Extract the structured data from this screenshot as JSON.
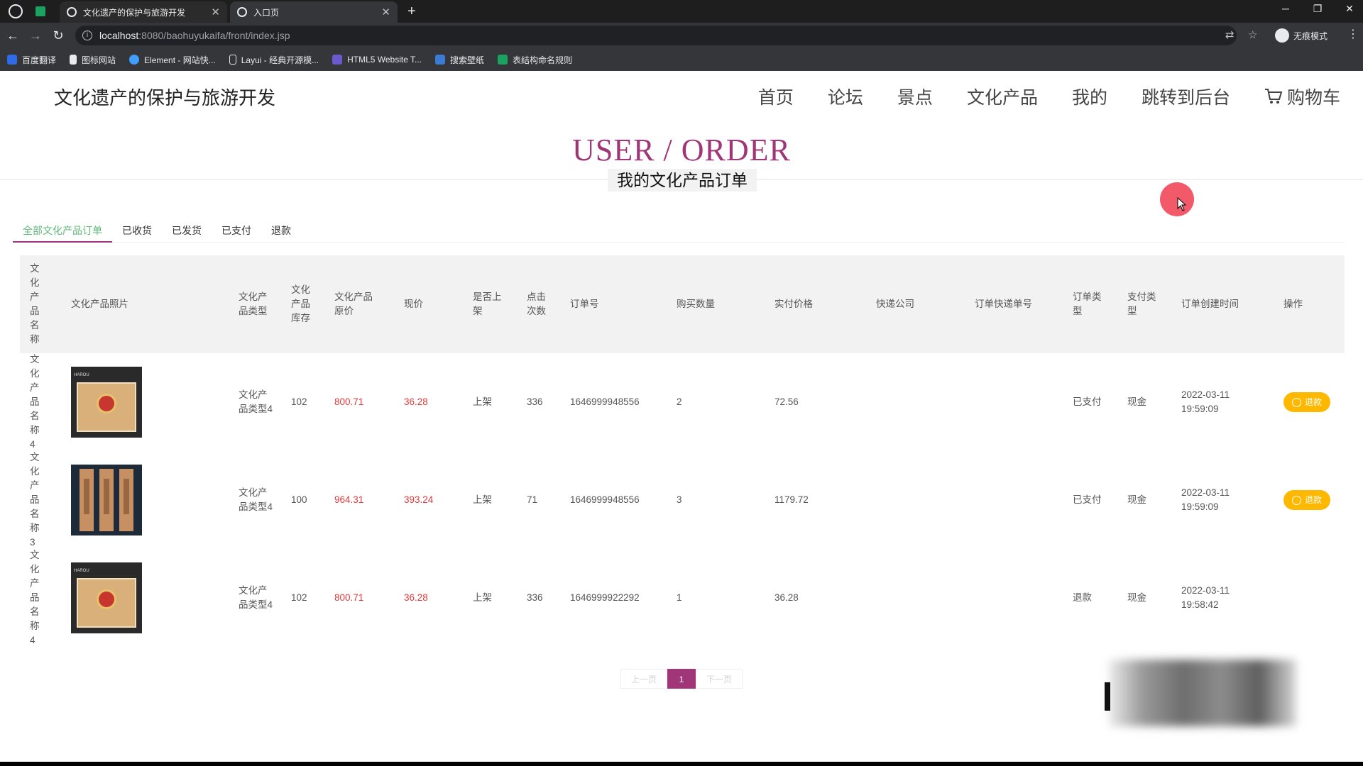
{
  "browser": {
    "tabs": [
      {
        "label": "文化遗产的保护与旅游开发"
      },
      {
        "label": "入口页"
      }
    ],
    "url_host": "localhost",
    "url_path": ":8080/baohuyukaifa/front/index.jsp",
    "incognito_label": "无痕模式",
    "bookmarks": [
      "百度翻译",
      "图标网站",
      "Element - 网站快...",
      "Layui - 经典开源模...",
      "HTML5 Website T...",
      "搜索壁纸",
      "表结构命名规则"
    ]
  },
  "site": {
    "title": "文化遗产的保护与旅游开发",
    "nav": [
      "首页",
      "论坛",
      "景点",
      "文化产品",
      "我的",
      "跳转到后台",
      "购物车"
    ]
  },
  "hero": {
    "title": "USER / ORDER",
    "subtitle": "我的文化产品订单"
  },
  "order_tabs": [
    "全部文化产品订单",
    "已收货",
    "已发货",
    "已支付",
    "退款"
  ],
  "table": {
    "headers": [
      "文化产品名称",
      "文化产品照片",
      "文化产品类型",
      "文化产品库存",
      "文化产品原价",
      "现价",
      "是否上架",
      "点击次数",
      "订单号",
      "购买数量",
      "实付价格",
      "快递公司",
      "订单快递单号",
      "订单类型",
      "支付类型",
      "订单创建时间",
      "操作"
    ],
    "rows": [
      {
        "name": "文化产品名称4",
        "photo": "box-icon",
        "type": "文化产品类型4",
        "stock": "102",
        "original_price": "800.71",
        "price": "36.28",
        "on_sale": "上架",
        "clicks": "336",
        "order_no": "1646999948556",
        "qty": "2",
        "paid": "72.56",
        "courier": "",
        "tracking": "",
        "order_type": "已支付",
        "pay_type": "现金",
        "date": "2022-03-11",
        "time": "19:59:09",
        "action": "退款"
      },
      {
        "name": "文化产品名称3",
        "photo": "sticks-icon",
        "type": "文化产品类型4",
        "stock": "100",
        "original_price": "964.31",
        "price": "393.24",
        "on_sale": "上架",
        "clicks": "71",
        "order_no": "1646999948556",
        "qty": "3",
        "paid": "1179.72",
        "courier": "",
        "tracking": "",
        "order_type": "已支付",
        "pay_type": "现金",
        "date": "2022-03-11",
        "time": "19:59:09",
        "action": "退款"
      },
      {
        "name": "文化产品名称4",
        "photo": "box-icon",
        "type": "文化产品类型4",
        "stock": "102",
        "original_price": "800.71",
        "price": "36.28",
        "on_sale": "上架",
        "clicks": "336",
        "order_no": "1646999922292",
        "qty": "1",
        "paid": "36.28",
        "courier": "",
        "tracking": "",
        "order_type": "退款",
        "pay_type": "现金",
        "date": "2022-03-11",
        "time": "19:58:42",
        "action": ""
      }
    ]
  },
  "pagination": {
    "prev": "上一页",
    "current": "1",
    "next": "下一页"
  },
  "colors": {
    "accent": "#a03577",
    "price_red": "#e4393c",
    "refund_button": "#ffb800",
    "active_tab_text": "#5fb878"
  }
}
